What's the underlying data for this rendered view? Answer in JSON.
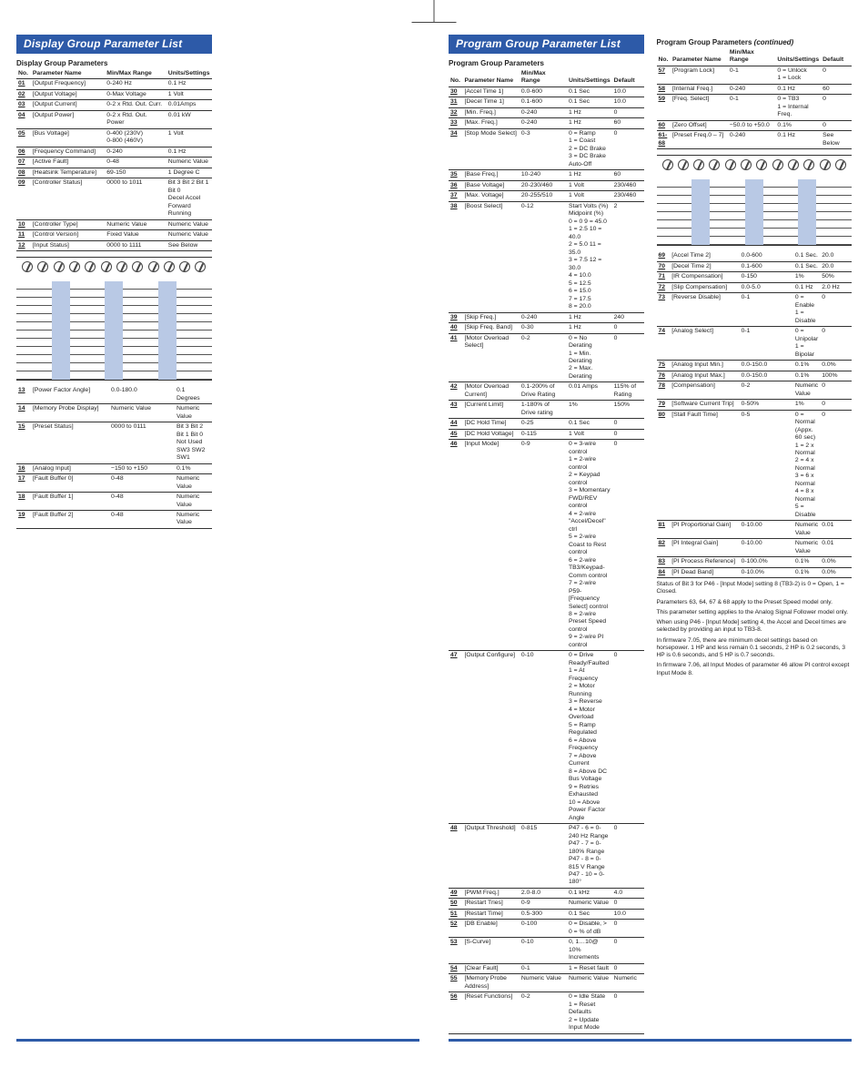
{
  "titles": {
    "display": "Display Group Parameter List",
    "program": "Program Group Parameter List"
  },
  "headers": {
    "no": "No.",
    "name": "Parameter Name",
    "range": "Min/Max Range",
    "units": "Units/Settings",
    "default": "Default",
    "display_sub": "Display Group Parameters",
    "program_sub": "Program Group Parameters",
    "program_sub_cont": "Program Group Parameters (continued)"
  },
  "display_a": [
    {
      "no": "01",
      "nm": "[Output Frequency]",
      "rng": "0-240 Hz",
      "us": "0.1 Hz",
      "df": ""
    },
    {
      "no": "02",
      "nm": "[Output Voltage]",
      "rng": "0-Max Voltage",
      "us": "1 Volt",
      "df": ""
    },
    {
      "no": "03",
      "nm": "[Output Current]",
      "rng": "0-2 x Rtd. Out. Curr.",
      "us": "0.01Amps",
      "df": ""
    },
    {
      "no": "04",
      "nm": "[Output Power]",
      "rng": "0-2 x Rtd. Out. Power",
      "us": "0.01 kW",
      "df": ""
    },
    {
      "no": "05",
      "nm": "[Bus Voltage]",
      "rng": "0-400 (230V)\n0-800 (460V)",
      "us": "1 Volt",
      "df": ""
    },
    {
      "no": "06",
      "nm": "[Frequency Command]",
      "rng": "0-240",
      "us": "0.1 Hz",
      "df": ""
    },
    {
      "no": "07",
      "nm": "[Active Fault]",
      "rng": "0-48",
      "us": "Numeric Value",
      "df": ""
    },
    {
      "no": "08",
      "nm": "[Heatsink Temperature]",
      "rng": "69-150",
      "us": "1 Degree C",
      "df": ""
    },
    {
      "no": "09",
      "nm": "[Controller Status]",
      "rng": "0000 to 1011",
      "us": "Bit 3   Bit 2   Bit 1   Bit 0\nDecel  Accel  Forward  Running",
      "df": ""
    },
    {
      "no": "10",
      "nm": "[Controller Type]",
      "rng": "Numeric Value",
      "us": "Numeric Value",
      "df": ""
    },
    {
      "no": "11",
      "nm": "[Control Version]",
      "rng": "Fixed Value",
      "us": "Numeric Value",
      "df": ""
    },
    {
      "no": "12",
      "nm": "[Input Status]",
      "rng": "0000 to 1111",
      "us": "See Below",
      "df": ""
    }
  ],
  "display_b": [
    {
      "no": "13",
      "nm": "[Power Factor Angle]",
      "rng": "0.0-180.0",
      "us": "0.1 Degrees",
      "df": ""
    },
    {
      "no": "14",
      "nm": "[Memory Probe Display]",
      "rng": "Numeric Value",
      "us": "Numeric Value",
      "df": ""
    },
    {
      "no": "15",
      "nm": "[Preset Status]",
      "rng": "0000 to 0111",
      "us": "Bit 3      Bit 2   Bit 1   Bit 0\nNot Used  SW3   SW2   SW1",
      "df": ""
    },
    {
      "no": "16",
      "nm": "[Analog Input]",
      "rng": "−150 to +150",
      "us": "0.1%",
      "df": ""
    },
    {
      "no": "17",
      "nm": "[Fault Buffer 0]",
      "rng": "0-48",
      "us": "Numeric Value",
      "df": ""
    },
    {
      "no": "18",
      "nm": "[Fault Buffer 1]",
      "rng": "0-48",
      "us": "Numeric Value",
      "df": ""
    },
    {
      "no": "19",
      "nm": "[Fault Buffer 2]",
      "rng": "0-48",
      "us": "Numeric Value",
      "df": ""
    }
  ],
  "program_a": [
    {
      "no": "30",
      "nm": "[Accel Time 1]",
      "rng": "0.0-600",
      "us": "0.1 Sec",
      "df": "10.0"
    },
    {
      "no": "31",
      "nm": "[Decel Time 1]",
      "rng": "0.1-600",
      "us": "0.1 Sec",
      "df": "10.0"
    },
    {
      "no": "32",
      "nm": "[Min. Freq.]",
      "rng": "0-240",
      "us": "1 Hz",
      "df": "0"
    },
    {
      "no": "33",
      "nm": "[Max. Freq.]",
      "rng": "0-240",
      "us": "1 Hz",
      "df": "60"
    },
    {
      "no": "34",
      "nm": "[Stop Mode Select]",
      "rng": "0-3",
      "us": "0 = Ramp\n1 = Coast\n2 = DC Brake\n3 = DC Brake Auto-Off",
      "df": "0"
    },
    {
      "no": "35",
      "nm": "[Base Freq.]",
      "rng": "10-240",
      "us": "1 Hz",
      "df": "60"
    },
    {
      "no": "36",
      "nm": "[Base Voltage]",
      "rng": "20-230/460",
      "us": "1 Volt",
      "df": "230/460"
    },
    {
      "no": "37",
      "nm": "[Max. Voltage]",
      "rng": "20-255/510",
      "us": "1 Volt",
      "df": "230/460"
    },
    {
      "no": "38",
      "nm": "[Boost Select]",
      "rng": "0-12",
      "us": "Start Volts (%)  Midpoint (%)\n0 = 0        9 = 45.0\n1 = 2.5     10 = 40.0\n2 = 5.0     11 = 35.0\n3 = 7.5     12 = 30.0\n4 = 10.0\n5 = 12.5\n6 = 15.0\n7 = 17.5\n8 = 20.0",
      "df": "2"
    },
    {
      "no": "39",
      "nm": "[Skip Freq.]",
      "rng": "0-240",
      "us": "1 Hz",
      "df": "240"
    },
    {
      "no": "40",
      "nm": "[Skip Freq. Band]",
      "rng": "0-30",
      "us": "1 Hz",
      "df": "0"
    },
    {
      "no": "41",
      "nm": "[Motor Overload Select]",
      "rng": "0-2",
      "us": "0 = No Derating\n1 = Min. Derating\n2 = Max. Derating",
      "df": "0"
    },
    {
      "no": "42",
      "nm": "[Motor Overload Current]",
      "rng": "0.1-200% of Drive Rating",
      "us": "0.01 Amps",
      "df": "115% of Rating"
    },
    {
      "no": "43",
      "nm": "[Current Limit]",
      "rng": "1-180% of Drive rating",
      "us": "1%",
      "df": "150%"
    },
    {
      "no": "44",
      "nm": "[DC Hold Time]",
      "rng": "0-25",
      "us": "0.1 Sec",
      "df": "0"
    },
    {
      "no": "45",
      "nm": "[DC Hold Voltage]",
      "rng": "0-115",
      "us": "1 Volt",
      "df": "0"
    },
    {
      "no": "46",
      "nm": "[Input Mode]",
      "rng": "0-9",
      "us": "0 = 3-wire control\n1 = 2-wire control\n2 = Keypad control\n3 = Momentary FWD/REV control\n4 = 2-wire \"Accel/Decel\" ctrl\n5 = 2-wire Coast to Rest control\n6 = 2-wire TB3/Keypad-Comm control\n7 = 2-wire P59-[Frequency Select] control\n8 = 2-wire Preset Speed control\n9 = 2-wire PI control",
      "df": "0"
    },
    {
      "no": "47",
      "nm": "[Output Configure]",
      "rng": "0-10",
      "us": "0 = Drive Ready/Faulted\n1 = At Frequency\n2 = Motor Running\n3 = Reverse\n4 = Motor Overload\n5 = Ramp Regulated\n6 = Above Frequency\n7 = Above Current\n8 = Above DC Bus Voltage\n9 = Retries Exhausted\n10 = Above Power Factor Angle",
      "df": "0"
    },
    {
      "no": "48",
      "nm": "[Output Threshold]",
      "rng": "0-815",
      "us": "P47 - 6 = 0-240 Hz Range\nP47 - 7 = 0-180% Range\nP47 - 8 = 0-815 V Range\nP47 - 10 = 0-180°",
      "df": "0"
    },
    {
      "no": "49",
      "nm": "[PWM Freq.]",
      "rng": "2.0-8.0",
      "us": "0.1 kHz",
      "df": "4.0"
    },
    {
      "no": "50",
      "nm": "[Restart Tries]",
      "rng": "0-9",
      "us": "Numeric Value",
      "df": "0"
    },
    {
      "no": "51",
      "nm": "[Restart Time]",
      "rng": "0.5-300",
      "us": "0.1 Sec",
      "df": "10.0"
    },
    {
      "no": "52",
      "nm": "[DB Enable]",
      "rng": "0-100",
      "us": "0 = Disable, > 0 = % of dB",
      "df": "0"
    },
    {
      "no": "53",
      "nm": "[S-Curve]",
      "rng": "0-10",
      "us": "0, 1…10@ 10% Increments",
      "df": "0"
    },
    {
      "no": "54",
      "nm": "[Clear Fault]",
      "rng": "0-1",
      "us": "1 = Reset fault",
      "df": "0"
    },
    {
      "no": "55",
      "nm": "[Memory Probe Address]",
      "rng": "Numeric Value",
      "us": "Numeric Value",
      "df": "Numeric"
    },
    {
      "no": "56",
      "nm": "[Reset Functions]",
      "rng": "0-2",
      "us": "0 = Idle State\n1 = Reset Defaults\n2 = Update Input Mode",
      "df": "0"
    }
  ],
  "program_b": [
    {
      "no": "57",
      "nm": "[Program Lock]",
      "rng": "0-1",
      "us": "0 = Unlock\n1 = Lock",
      "df": "0"
    },
    {
      "no": "58",
      "nm": "[Internal Freq.]",
      "rng": "0-240",
      "us": "0.1 Hz",
      "df": "60"
    },
    {
      "no": "59",
      "nm": "[Freq. Select]",
      "rng": "0-1",
      "us": "0 = TB3\n1 = Internal Freq.",
      "df": "0"
    },
    {
      "no": "60",
      "nm": "[Zero Offset]",
      "rng": "−50.0 to +50.0",
      "us": "0.1%",
      "df": "0"
    },
    {
      "no": "61-68",
      "nm": "[Preset Freq.0 – 7]",
      "rng": "0-240",
      "us": "0.1 Hz",
      "df": "See Below"
    }
  ],
  "program_c": [
    {
      "no": "69",
      "nm": "[Accel Time 2]",
      "rng": "0.0-600",
      "us": "0.1 Sec.",
      "df": "20.0"
    },
    {
      "no": "70",
      "nm": "[Decel Time 2]",
      "rng": "0.1-600",
      "us": "0.1 Sec.",
      "df": "20.0"
    },
    {
      "no": "71",
      "nm": "[IR Compensation]",
      "rng": "0-150",
      "us": "1%",
      "df": "50%"
    },
    {
      "no": "72",
      "nm": "[Slip Compensation]",
      "rng": "0.0-5.0",
      "us": "0.1 Hz",
      "df": "2.0 Hz"
    },
    {
      "no": "73",
      "nm": "[Reverse Disable]",
      "rng": "0-1",
      "us": "0 = Enable\n1 = Disable",
      "df": "0"
    },
    {
      "no": "74",
      "nm": "[Analog Select]",
      "rng": "0-1",
      "us": "0 = Unipolar\n1 = Bipolar",
      "df": "0"
    },
    {
      "no": "75",
      "nm": "[Analog Input Min.]",
      "rng": "0.0-150.0",
      "us": "0.1%",
      "df": "0.0%"
    },
    {
      "no": "76",
      "nm": "[Analog Input Max.]",
      "rng": "0.0-150.0",
      "us": "0.1%",
      "df": "100%"
    },
    {
      "no": "78",
      "nm": "[Compensation]",
      "rng": "0-2",
      "us": "Numeric Value",
      "df": "0"
    },
    {
      "no": "79",
      "nm": "[Software Current Trip]",
      "rng": "0-50%",
      "us": "1%",
      "df": "0"
    },
    {
      "no": "80",
      "nm": "[Stall Fault Time]",
      "rng": "0-5",
      "us": "0 = Normal (Appx. 60 sec)\n1 = 2 x Normal\n2 = 4 x Normal\n3 = 6 x Normal\n4 = 8 x Normal\n5 = Disable",
      "df": "0"
    },
    {
      "no": "81",
      "nm": "[PI Proportional Gain]",
      "rng": "0-10.00",
      "us": "Numeric Value",
      "df": "0.01"
    },
    {
      "no": "82",
      "nm": "[PI Integral Gain]",
      "rng": "0-10.00",
      "us": "Numeric Value",
      "df": "0.01"
    },
    {
      "no": "83",
      "nm": "[PI Process Reference]",
      "rng": "0-100.0%",
      "us": "0.1%",
      "df": "0.0%"
    },
    {
      "no": "84",
      "nm": "[PI Dead Band]",
      "rng": "0-10.0%",
      "us": "0.1%",
      "df": "0.0%"
    }
  ],
  "notes": [
    "Status of Bit 3 for P46 - [Input Mode] setting 8 (TB3-2) is 0 = Open, 1 = Closed.",
    "Parameters 63, 64, 67 & 68 apply to the Preset Speed model only.",
    "This parameter setting applies to the Analog Signal Follower model only.",
    "When using P46 - [Input Mode] setting 4, the Accel and Decel times are selected by providing an input to TB3-8.",
    "In firmware 7.05, there are minimum decel settings based on horsepower. 1 HP and less remain 0.1 seconds, 2 HP is 0.2 seconds, 3 HP is 0.6 seconds, and 5 HP is 0.7 seconds.",
    "In firmware 7.06, all Input Modes of parameter 46 allow PI control except Input Mode 8."
  ]
}
